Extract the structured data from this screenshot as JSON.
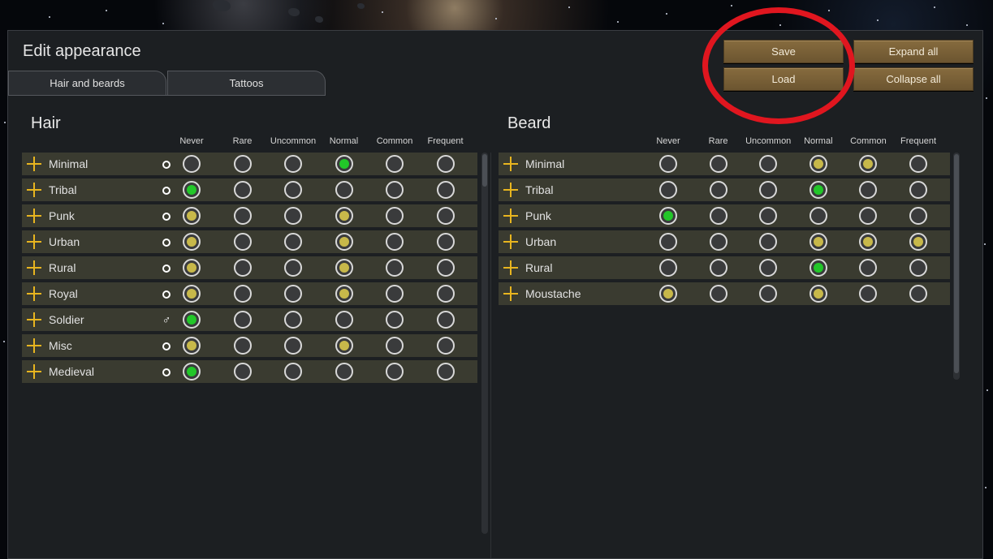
{
  "window": {
    "title": "Edit appearance"
  },
  "tabs": [
    {
      "label": "Hair and beards",
      "active": true
    },
    {
      "label": "Tattoos",
      "active": false
    }
  ],
  "buttons": {
    "save": "Save",
    "load": "Load",
    "expand_all": "Expand all",
    "collapse_all": "Collapse all"
  },
  "frequency_levels": [
    "Never",
    "Rare",
    "Uncommon",
    "Normal",
    "Common",
    "Frequent"
  ],
  "hair": {
    "title": "Hair",
    "rows": [
      {
        "label": "Minimal",
        "gender": "any",
        "selected": [
          "none",
          "none",
          "none",
          "green",
          "none",
          "none"
        ]
      },
      {
        "label": "Tribal",
        "gender": "any",
        "selected": [
          "green",
          "none",
          "none",
          "none",
          "none",
          "none"
        ]
      },
      {
        "label": "Punk",
        "gender": "any",
        "selected": [
          "yellow",
          "none",
          "none",
          "yellow",
          "none",
          "none"
        ]
      },
      {
        "label": "Urban",
        "gender": "any",
        "selected": [
          "yellow",
          "none",
          "none",
          "yellow",
          "none",
          "none"
        ]
      },
      {
        "label": "Rural",
        "gender": "any",
        "selected": [
          "yellow",
          "none",
          "none",
          "yellow",
          "none",
          "none"
        ]
      },
      {
        "label": "Royal",
        "gender": "any",
        "selected": [
          "yellow",
          "none",
          "none",
          "yellow",
          "none",
          "none"
        ]
      },
      {
        "label": "Soldier",
        "gender": "male",
        "selected": [
          "green",
          "none",
          "none",
          "none",
          "none",
          "none"
        ]
      },
      {
        "label": "Misc",
        "gender": "any",
        "selected": [
          "yellow",
          "none",
          "none",
          "yellow",
          "none",
          "none"
        ]
      },
      {
        "label": "Medieval",
        "gender": "any",
        "selected": [
          "green",
          "none",
          "none",
          "none",
          "none",
          "none"
        ]
      }
    ]
  },
  "beard": {
    "title": "Beard",
    "rows": [
      {
        "label": "Minimal",
        "selected": [
          "none",
          "none",
          "none",
          "yellow",
          "yellow",
          "none"
        ]
      },
      {
        "label": "Tribal",
        "selected": [
          "none",
          "none",
          "none",
          "green",
          "none",
          "none"
        ]
      },
      {
        "label": "Punk",
        "selected": [
          "green",
          "none",
          "none",
          "none",
          "none",
          "none"
        ]
      },
      {
        "label": "Urban",
        "selected": [
          "none",
          "none",
          "none",
          "yellow",
          "yellow",
          "yellow"
        ]
      },
      {
        "label": "Rural",
        "selected": [
          "none",
          "none",
          "none",
          "green",
          "none",
          "none"
        ]
      },
      {
        "label": "Moustache",
        "selected": [
          "yellow",
          "none",
          "none",
          "yellow",
          "none",
          "none"
        ]
      }
    ]
  },
  "colors": {
    "selected_green": "#22c629",
    "selected_yellow": "#c7b84a",
    "button_brown": "#7a6137",
    "annotation_red": "#e0161f",
    "row_background": "#3a3b30",
    "plus_icon": "#e8b51f"
  }
}
